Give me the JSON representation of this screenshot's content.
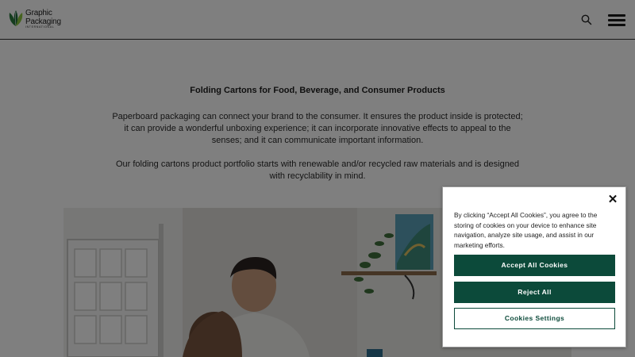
{
  "header": {
    "logo_line1": "Graphic",
    "logo_line2": "Packaging",
    "logo_line3": "INTERNATIONAL",
    "search_icon": "search-icon",
    "menu_icon": "hamburger-menu-icon"
  },
  "main": {
    "heading": "Folding Cartons for Food, Beverage, and Consumer Products",
    "paragraph1": "Paperboard packaging can connect your brand to the consumer. It ensures the product inside is protected; it can provide a wonderful unboxing experience; it can incorporate innovative effects to appeal to the senses; and it can communicate important information.",
    "paragraph2": "Our folding cartons product portfolio starts with renewable and/or recycled raw materials and is designed with recyclability in mind."
  },
  "cookie_banner": {
    "close_icon": "close-icon",
    "text": "By clicking “Accept All Cookies”, you agree to the storing of cookies on your device to enhance site navigation, analyze site usage, and assist in our marketing efforts.",
    "accept_label": "Accept All Cookies",
    "reject_label": "Reject All",
    "settings_label": "Cookies Settings"
  },
  "colors": {
    "brand_green": "#0c4a3a",
    "logo_green": "#1f6b3a",
    "logo_lime": "#8dc63f",
    "overlay": "rgba(0,0,0,0.5)"
  }
}
